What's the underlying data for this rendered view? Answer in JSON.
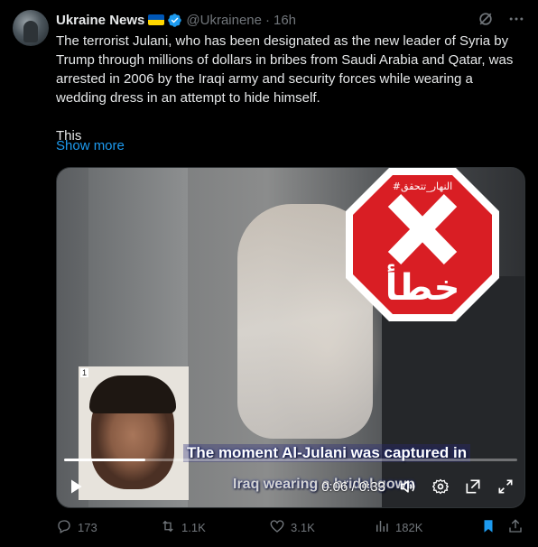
{
  "post": {
    "author_name": "Ukraine News",
    "handle": "@Ukrainene",
    "separator": "·",
    "time": "16h",
    "text_p1": "The terrorist Julani, who has been designated as the new leader of Syria by Trump through millions of dollars in bribes from Saudi Arabia and Qatar, was arrested in 2006 by the Iraqi army and security forces while wearing a wedding dress in an attempt to hide himself.",
    "text_p2": "This",
    "show_more": "Show more"
  },
  "media": {
    "stamp_top": "#النهار_تتحقق",
    "stamp_bottom": "خطأ",
    "inset_number": "1",
    "caption_line1": "The moment Al-Julani was captured in",
    "caption_line2": "Iraq wearing a bridal gown",
    "time_label": "0:06 / 0:33",
    "progress": 0.18
  },
  "actions": {
    "replies": "173",
    "reposts": "1.1K",
    "likes": "3.1K",
    "views": "182K"
  },
  "colors": {
    "accent": "#1d9bf0",
    "stamp_red": "#d91e24",
    "muted": "#71767b"
  },
  "icons": [
    "grok-icon",
    "more-icon",
    "verified-icon",
    "play-icon",
    "volume-icon",
    "settings-icon",
    "exit-icon",
    "fullscreen-icon",
    "reply-icon",
    "repost-icon",
    "like-icon",
    "views-icon",
    "bookmark-icon",
    "share-icon"
  ]
}
